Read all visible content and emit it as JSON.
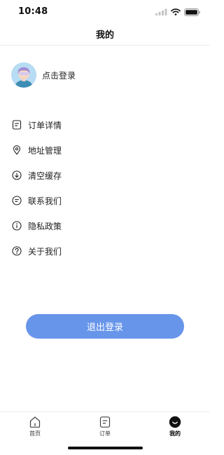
{
  "status": {
    "time": "10:48"
  },
  "header": {
    "title": "我的"
  },
  "profile": {
    "login_text": "点击登录"
  },
  "menu": {
    "items": [
      {
        "label": "订单详情",
        "icon": "order-icon"
      },
      {
        "label": "地址管理",
        "icon": "location-pin-icon"
      },
      {
        "label": "清空缓存",
        "icon": "download-circle-icon"
      },
      {
        "label": "联系我们",
        "icon": "message-circle-icon"
      },
      {
        "label": "隐私政策",
        "icon": "info-circle-icon"
      },
      {
        "label": "关于我们",
        "icon": "question-circle-icon"
      }
    ]
  },
  "logout": {
    "label": "退出登录"
  },
  "tabbar": {
    "items": [
      {
        "label": "首页",
        "icon": "home-icon",
        "active": false
      },
      {
        "label": "订单",
        "icon": "order-icon",
        "active": false
      },
      {
        "label": "我的",
        "icon": "smile-face-icon",
        "active": true
      }
    ]
  },
  "colors": {
    "accent": "#6795ea",
    "avatar_bg": "#b7dcf3",
    "divider": "#ececec"
  }
}
